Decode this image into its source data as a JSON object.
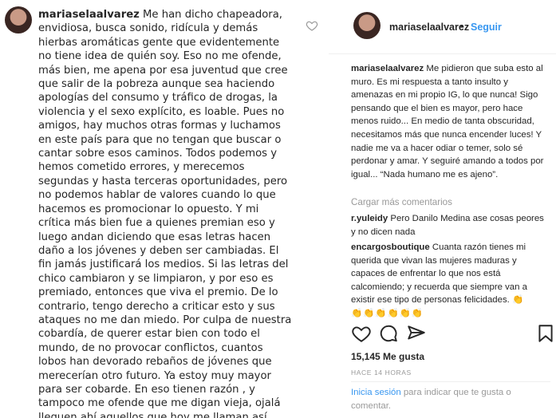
{
  "left_post": {
    "username": "mariaselaalvarez",
    "text": "Me han dicho chapeadora, envidiosa, busca sonido, ridícula y demás hierbas aromáticas gente que evidentemente no tiene idea de quién soy. Eso no me ofende, más bien, me apena por esa juventud que cree que salir de la pobreza aunque sea haciendo apologías del consumo y tráfico de drogas, la violencia y el sexo explícito, es loable. Pues no amigos, hay muchos otras formas y luchamos en este país para que no tengan que buscar o cantar sobre esos caminos. Todos podemos y hemos cometido errores, y merecemos segundas y hasta terceras oportunidades, pero no podemos hablar de valores cuando lo que hacemos es promocionar lo opuesto. Y mi crítica más bien fue a quienes premian eso y luego andan diciendo que esas letras hacen daño a los jóvenes y deben ser cambiadas. El fin jamás justificará los medios. Si las letras del chico cambiaron y se limpiaron, y por eso es premiado, entonces que viva el premio. De lo contrario, tengo derecho a criticar esto y sus ataques no me dan miedo. Por culpa de nuestra cobardía, de querer estar bien con todo el mundo, de no provocar conflictos, cuantos lobos han devorado rebaños de jóvenes que merecerían otro futuro. Ya estoy muy mayor para ser cobarde. En eso tienen razón , y tampoco me ofende que me digan vieja, ojalá lleguen ahí aquellos que hoy me llaman así.",
    "heart_icon": "heart-outline-icon"
  },
  "right_post": {
    "header": {
      "username": "mariaselaalvarez",
      "separator": "•",
      "follow_label": "Seguir"
    },
    "caption": {
      "username": "mariaselaalvarez",
      "text": "Me pidieron que suba esto al muro. Es mi respuesta a tanto insulto y amenazas en mi propio IG, lo que nunca! Sigo pensando que el bien es mayor, pero hace menos ruido... En medio de tanta obscuridad, necesitamos más que nunca encender luces! Y nadie me va a hacer odiar o temer, solo sé perdonar y amar. Y seguiré amando a todos por igual... “Nada humano me es ajeno”."
    },
    "load_more": "Cargar más comentarios",
    "comments": [
      {
        "username": "r.yuleidy",
        "text": "Pero Danilo Medina ase cosas peores y no dicen nada"
      },
      {
        "username": "encargosboutique",
        "text": "Cuanta razón tienes mi querida que vivan las mujeres maduras y capaces de enfrentar lo que nos está calcomiendo; y recuerda que siempre van a existir ese tipo de personas felicidades.",
        "emoji_trail": "👏",
        "emoji_row": "👏👏👏👏👏👏"
      }
    ],
    "actions": {
      "like_icon": "heart-outline-icon",
      "comment_icon": "comment-bubble-icon",
      "share_icon": "share-plane-icon",
      "save_icon": "bookmark-icon"
    },
    "likes": "15,145 Me gusta",
    "time": "HACE 14 HORAS",
    "login": {
      "link": "Inicia sesión",
      "text": " para indicar que te gusta o comentar."
    }
  }
}
